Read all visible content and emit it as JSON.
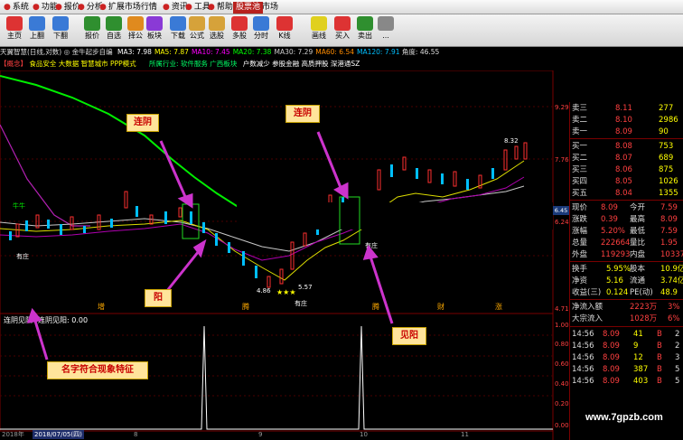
{
  "menu": {
    "items": [
      "系统",
      "功能",
      "报价",
      "分析",
      "扩展市场行情",
      "资讯",
      "工具",
      "帮助"
    ],
    "tabs": [
      "股票池",
      "市场"
    ]
  },
  "toolbar": {
    "buttons": [
      "主页",
      "上翻",
      "下翻",
      "报价",
      "自选",
      "择公",
      "板块",
      "下载",
      "公式",
      "选股",
      "多股",
      "分时",
      "K线",
      "画线",
      "买入",
      "卖出",
      "..."
    ]
  },
  "info": {
    "title": "天翼智慧(日线,对数)",
    "indicator": "◎ 金牛起步自编",
    "ma": [
      {
        "label": "MA3",
        "value": "7.98",
        "color": "#ffffff"
      },
      {
        "label": "MA5",
        "value": "7.87",
        "color": "#ffff00"
      },
      {
        "label": "MA10",
        "value": "7.45",
        "color": "#ff00ff"
      },
      {
        "label": "MA20",
        "value": "7.38",
        "color": "#00ff00"
      },
      {
        "label": "MA30",
        "value": "7.29",
        "color": "#cccccc"
      },
      {
        "label": "MA60",
        "value": "6.54",
        "color": "#ff8c00"
      },
      {
        "label": "MA120",
        "value": "7.91",
        "color": "#00bfff"
      }
    ],
    "angle": "角度: 46.55",
    "concept_label": "【概念】",
    "concepts": "食品安全 大数据 智慧城市 PPP模式",
    "industry": "所属行业: 软件服务 广西板块",
    "extra": "户数减少 参股金融 高质押股 深港通SZ"
  },
  "chart_data": [
    {
      "type": "candlestick",
      "title": "天翼智慧(日线,对数)",
      "ylim": [
        4.6,
        9.4
      ],
      "y_ticks": [
        "9.29",
        "7.76",
        "6.45",
        "6.24",
        "4.71"
      ],
      "x_ticks": [
        "2018",
        "2018/07/05",
        "8",
        "9",
        "10",
        "11"
      ],
      "annotations": [
        "8.32",
        "4.86",
        "5.57",
        "有庄",
        "有庄",
        "有庄",
        "牛牛"
      ],
      "markers": [
        "增",
        "腾",
        "腾",
        "财",
        "涨"
      ]
    },
    {
      "type": "line",
      "title": "连阴见阳",
      "legend": "连阴见阳: 0.00",
      "y_ticks": [
        "1.00",
        "0.80",
        "0.60",
        "0.40",
        "0.20",
        "0.00"
      ],
      "signal_x": [
        "2018-09",
        "2018-10"
      ],
      "values": [
        0,
        1,
        0,
        1,
        0
      ]
    }
  ],
  "callouts": {
    "top_left": "连阴",
    "top_right": "连阴",
    "yang": "阳",
    "jianyang": "见阳",
    "feature": "名字符合现象特征"
  },
  "price_tag": "6.45",
  "date_left": "2018年",
  "date_badge": "2018/07/05(四)",
  "watermark": "www.7gpzb.com",
  "panel": {
    "sells": [
      {
        "label": "卖三",
        "price": "8.11",
        "vol": "277"
      },
      {
        "label": "卖二",
        "price": "8.10",
        "vol": "2986"
      },
      {
        "label": "卖一",
        "price": "8.09",
        "vol": "90"
      }
    ],
    "buys": [
      {
        "label": "买一",
        "price": "8.08",
        "vol": "753"
      },
      {
        "label": "买二",
        "price": "8.07",
        "vol": "689"
      },
      {
        "label": "买三",
        "price": "8.06",
        "vol": "875"
      },
      {
        "label": "买四",
        "price": "8.05",
        "vol": "1026"
      },
      {
        "label": "买五",
        "price": "8.04",
        "vol": "1355"
      }
    ],
    "stats1": [
      {
        "l1": "现价",
        "v1": "8.09",
        "l2": "今开",
        "v2": "7.59"
      },
      {
        "l1": "涨跌",
        "v1": "0.39",
        "l2": "最高",
        "v2": "8.09"
      },
      {
        "l1": "涨幅",
        "v1": "5.20%",
        "l2": "最低",
        "v2": "7.59"
      },
      {
        "l1": "总量",
        "v1": "222664",
        "l2": "量比",
        "v2": "1.95"
      },
      {
        "l1": "外盘",
        "v1": "119293",
        "l2": "内盘",
        "v2": "103370"
      }
    ],
    "stats2": [
      {
        "l1": "换手",
        "v1": "5.95%",
        "l2": "股本",
        "v2": "10.9亿"
      },
      {
        "l1": "净资",
        "v1": "5.16",
        "l2": "流通",
        "v2": "3.74亿"
      },
      {
        "l1": "收益(三)",
        "v1": "0.124",
        "l2": "PE(动)",
        "v2": "48.9"
      }
    ],
    "flows": [
      {
        "label": "净流入额",
        "value": "2223万",
        "pct": "3%"
      },
      {
        "label": "大宗流入",
        "value": "1028万",
        "pct": "6%"
      }
    ],
    "ticks": [
      {
        "time": "14:56",
        "price": "8.09",
        "vol": "41",
        "bs": "B",
        "n": "2"
      },
      {
        "time": "14:56",
        "price": "8.09",
        "vol": "9",
        "bs": "B",
        "n": "2"
      },
      {
        "time": "14:56",
        "price": "8.09",
        "vol": "12",
        "bs": "B",
        "n": "3"
      },
      {
        "time": "14:56",
        "price": "8.09",
        "vol": "387",
        "bs": "B",
        "n": "5"
      },
      {
        "time": "14:56",
        "price": "8.09",
        "vol": "403",
        "bs": "B",
        "n": "5"
      }
    ]
  }
}
